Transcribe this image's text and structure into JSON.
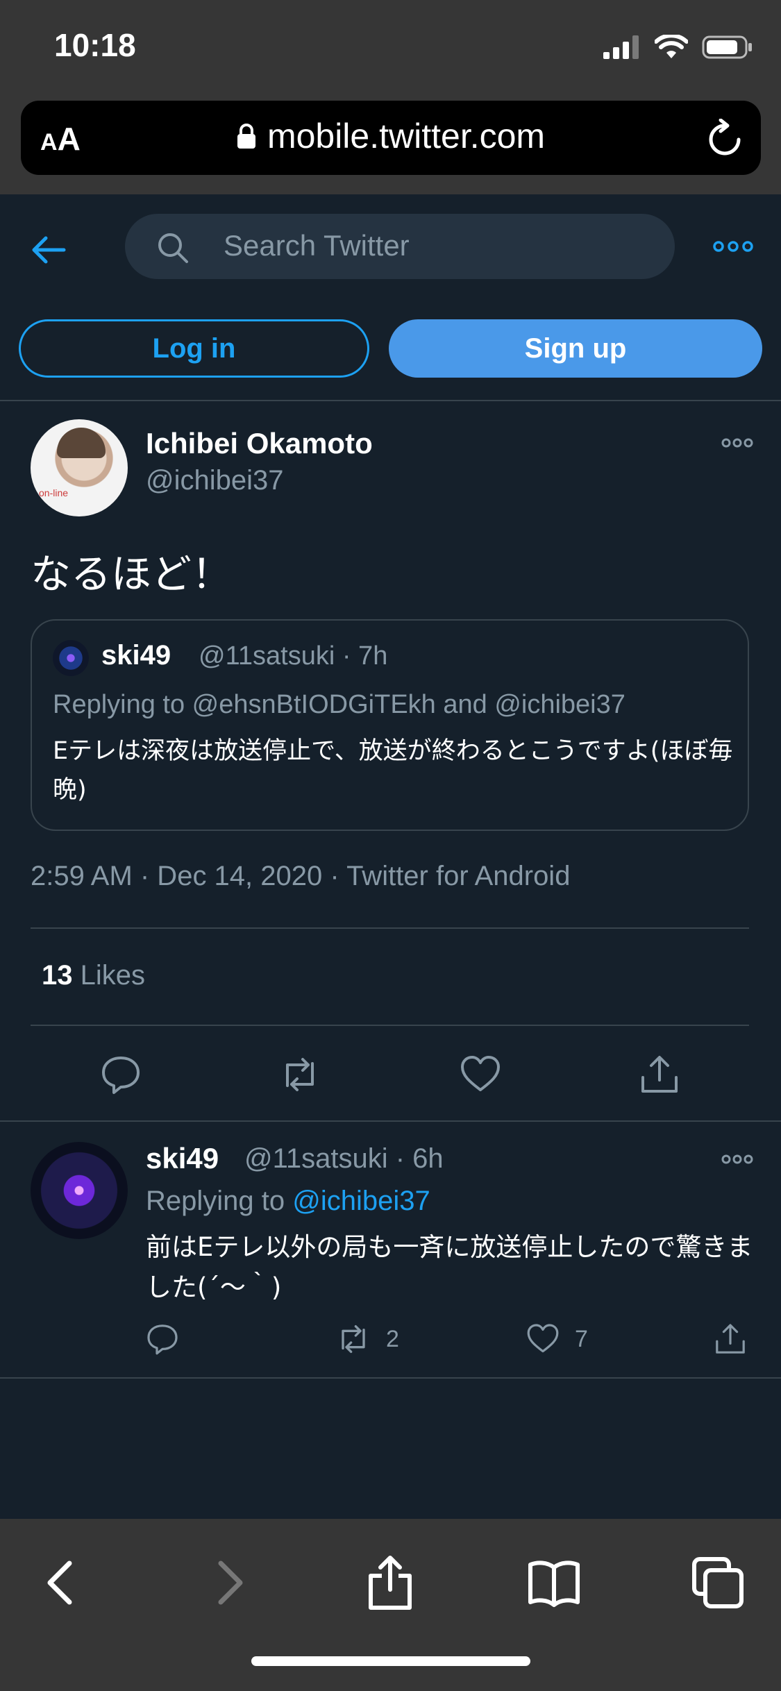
{
  "status_bar": {
    "time": "10:18"
  },
  "browser": {
    "text_size_small": "A",
    "text_size_large": "A",
    "url": "mobile.twitter.com"
  },
  "header": {
    "search_placeholder": "Search Twitter",
    "login_label": "Log in",
    "signup_label": "Sign up"
  },
  "tweet": {
    "author_name": "Ichibei Okamoto",
    "author_handle": "@ichibei37",
    "text": "なるほど！",
    "quote": {
      "name": "ski49",
      "meta": "@11satsuki · 7h",
      "replying_to": "Replying to @ehsnBtIODGiTEkh and @ichibei37",
      "text": "Eテレは深夜は放送停止で、放送が終わるとこうですよ(ほぼ毎晩)"
    },
    "timestamp": "2:59 AM · Dec 14, 2020 · Twitter for Android",
    "likes_count": "13",
    "likes_label": "Likes"
  },
  "reply": {
    "name": "ski49",
    "meta": "@11satsuki · 6h",
    "replying_prefix": "Replying to",
    "replying_handle": "@ichibei37",
    "text": "前はEテレ以外の局も一斉に放送停止したので驚きました(´〜｀)",
    "retweets": "2",
    "likes": "7"
  },
  "colors": {
    "background": "#15202b",
    "accent": "#1da1f2",
    "muted": "#8899a6",
    "divider": "#38444d",
    "chrome": "#363636"
  }
}
